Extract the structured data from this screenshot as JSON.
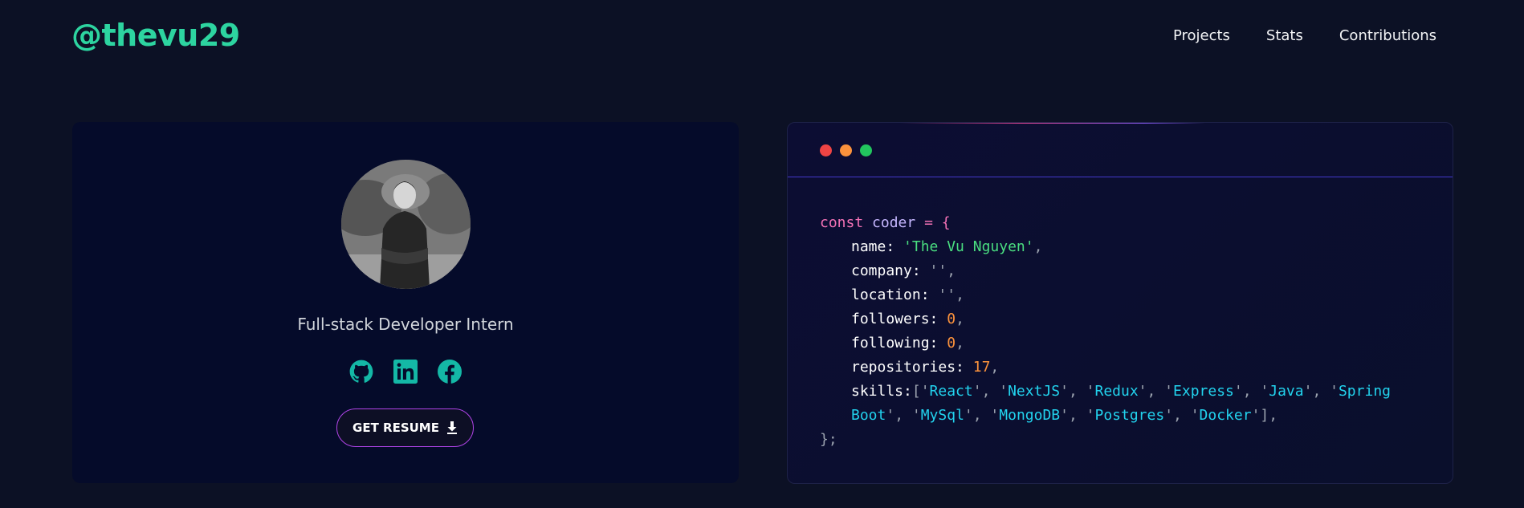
{
  "header": {
    "logo": "@thevu29",
    "nav": [
      "Projects",
      "Stats",
      "Contributions"
    ]
  },
  "profile": {
    "role": "Full-stack Developer Intern",
    "socials": [
      "github-icon",
      "linkedin-icon",
      "facebook-icon"
    ],
    "resume_label": "GET RESUME",
    "accent_color": "#14b8a6"
  },
  "code": {
    "keyword": "const",
    "var_name": "coder",
    "open": "= {",
    "name_key": "name:",
    "name_val": "'The Vu Nguyen'",
    "company_key": "company:",
    "company_val": "''",
    "location_key": "location:",
    "location_val": "''",
    "followers_key": "followers:",
    "followers_val": "0",
    "following_key": "following:",
    "following_val": "0",
    "repos_key": "repositories:",
    "repos_val": "17",
    "skills_key": "skills:",
    "skills": [
      "React",
      "NextJS",
      "Redux",
      "Express",
      "Java",
      "Spring Boot",
      "MySql",
      "MongoDB",
      "Postgres",
      "Docker"
    ],
    "close": "};"
  }
}
